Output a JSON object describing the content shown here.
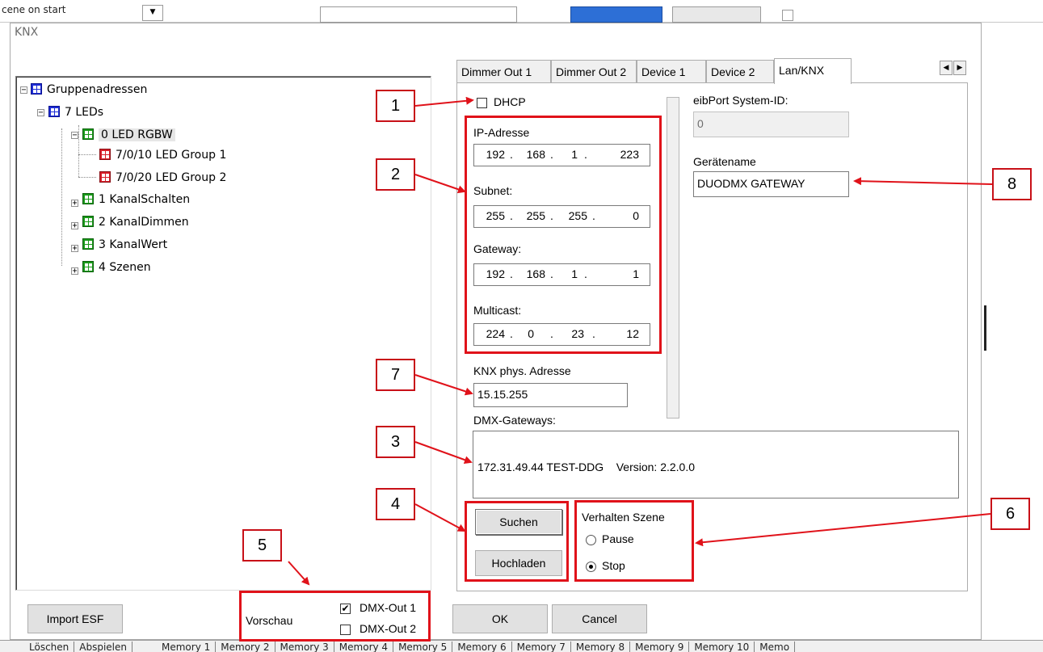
{
  "background": {
    "top_left": "cene on start",
    "bottom_left": [
      "Löschen",
      "Abspielen"
    ],
    "memory_tabs": [
      "Memory 1",
      "Memory 2",
      "Memory 3",
      "Memory 4",
      "Memory 5",
      "Memory 6",
      "Memory 7",
      "Memory 8",
      "Memory 9",
      "Memory 10",
      "Memo"
    ]
  },
  "dialog": {
    "title": "KNX"
  },
  "tree": {
    "root": "Gruppenadressen",
    "nodes": [
      {
        "label": "7 LEDs",
        "icon": "blue"
      },
      {
        "label": "0 LED RGBW",
        "icon": "green"
      },
      {
        "label": "7/0/10 LED Group 1",
        "icon": "red"
      },
      {
        "label": "7/0/20 LED Group 2",
        "icon": "red"
      },
      {
        "label": "1 KanalSchalten",
        "icon": "green"
      },
      {
        "label": "2 KanalDimmen",
        "icon": "green"
      },
      {
        "label": "3 KanalWert",
        "icon": "green"
      },
      {
        "label": "4 Szenen",
        "icon": "green"
      }
    ]
  },
  "tabs": [
    "Dimmer Out 1",
    "Dimmer Out 2",
    "Device 1",
    "Device 2",
    "Lan/KNX"
  ],
  "active_tab": "Lan/KNX",
  "lan": {
    "dhcp_label": "DHCP",
    "ip_label": "IP-Adresse",
    "ip": [
      "192",
      "168",
      "1",
      "223"
    ],
    "subnet_label": "Subnet:",
    "subnet": [
      "255",
      "255",
      "255",
      "0"
    ],
    "gateway_label": "Gateway:",
    "gateway": [
      "192",
      "168",
      "1",
      "1"
    ],
    "multicast_label": "Multicast:",
    "multicast": [
      "224",
      "0",
      "23",
      "12"
    ],
    "knx_label": "KNX phys. Adresse",
    "knx_value": "15.15.255",
    "eibport_label": "eibPort System-ID:",
    "eibport_value": "0",
    "geraetename_label": "Gerätename",
    "geraetename_value": "DUODMX GATEWAY",
    "dmx_label": "DMX-Gateways:",
    "dmx_list": [
      "172.31.49.44 TEST-DDG    Version: 2.2.0.0"
    ],
    "suchen": "Suchen",
    "hochladen": "Hochladen",
    "verhalten_label": "Verhalten Szene",
    "pause": "Pause",
    "stop": "Stop",
    "selected_behavior": "Stop"
  },
  "footer": {
    "import": "Import ESF",
    "vorschau": "Vorschau",
    "dmx_out1": "DMX-Out 1",
    "dmx_out2": "DMX-Out 2",
    "dmx_out1_checked": true,
    "dmx_out2_checked": false,
    "ok": "OK",
    "cancel": "Cancel"
  },
  "annotations": [
    "1",
    "2",
    "3",
    "4",
    "5",
    "6",
    "7",
    "8"
  ],
  "colors": {
    "annotation": "#e0121a",
    "group_blue": "#1e2dd6",
    "group_green": "#1a9a1a",
    "group_red": "#d8202a"
  }
}
